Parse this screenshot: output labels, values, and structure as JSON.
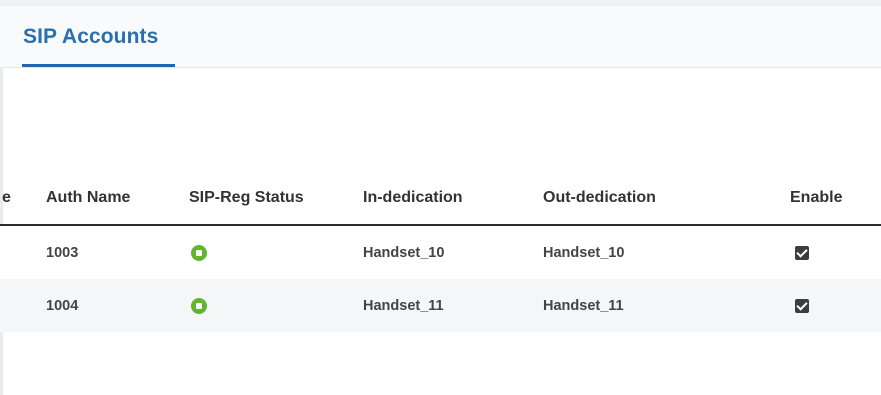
{
  "tabs": {
    "active_label": "SIP Accounts"
  },
  "table": {
    "columns": {
      "edge": "e",
      "auth_name": "Auth Name",
      "sip_reg_status": "SIP-Reg Status",
      "in_dedication": "In-dedication",
      "out_dedication": "Out-dedication",
      "enable": "Enable"
    },
    "rows": [
      {
        "auth_name": "1003",
        "sip_reg_status": "registered",
        "in_dedication": "Handset_10",
        "out_dedication": "Handset_10",
        "enable": "checked"
      },
      {
        "auth_name": "1004",
        "sip_reg_status": "registered",
        "in_dedication": "Handset_11",
        "out_dedication": "Handset_11",
        "enable": "checked"
      }
    ]
  },
  "colors": {
    "tab_accent": "#1e67ad",
    "status_ok": "#62b52f"
  },
  "icons": {
    "status": "status-registered-icon",
    "enable": "checkbox-checked-icon"
  }
}
